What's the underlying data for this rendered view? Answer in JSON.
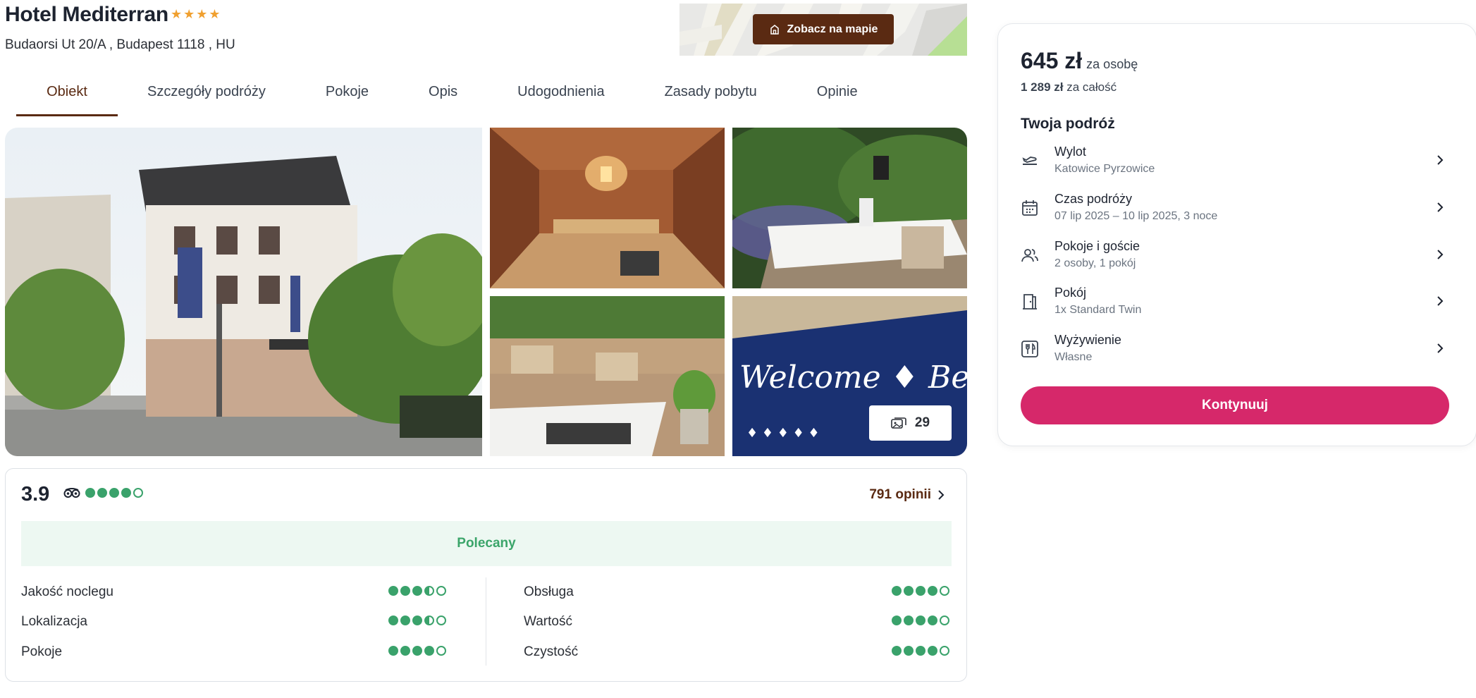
{
  "hotel": {
    "name": "Hotel Mediterran",
    "stars": 4,
    "address": "Budaorsi Ut 20/A , Budapest 1118 , HU"
  },
  "map": {
    "button_label": "Zobacz na mapie",
    "icon": "map-marker-icon"
  },
  "tabs": [
    {
      "label": "Obiekt",
      "active": true
    },
    {
      "label": "Szczegóły podróży",
      "active": false
    },
    {
      "label": "Pokoje",
      "active": false
    },
    {
      "label": "Opis",
      "active": false
    },
    {
      "label": "Udogodnienia",
      "active": false
    },
    {
      "label": "Zasady pobytu",
      "active": false
    },
    {
      "label": "Opinie",
      "active": false
    }
  ],
  "gallery": {
    "photo_count": "29",
    "icon": "gallery-icon"
  },
  "ratings": {
    "score": "3.9",
    "score_dots": 4,
    "reviews_link": "791 opinii",
    "recommendation": "Polecany",
    "categories_left": [
      {
        "label": "Jakość noclegu",
        "value": 3.5
      },
      {
        "label": "Lokalizacja",
        "value": 3.5
      },
      {
        "label": "Pokoje",
        "value": 4
      }
    ],
    "categories_right": [
      {
        "label": "Obsługa",
        "value": 4
      },
      {
        "label": "Wartość",
        "value": 4
      },
      {
        "label": "Czystość",
        "value": 4
      }
    ],
    "colors": {
      "dot": "#3aa26b",
      "recommend_bg": "#edf8f2"
    }
  },
  "sidebar": {
    "price": "645 zł",
    "price_unit": "za osobę",
    "total": "1 289 zł",
    "total_unit": "za całość",
    "trip_title": "Twoja podróż",
    "items": [
      {
        "label": "Wylot",
        "value": "Katowice Pyrzowice",
        "icon": "plane-icon"
      },
      {
        "label": "Czas podróży",
        "value": "07 lip 2025 – 10 lip 2025, 3 noce",
        "icon": "calendar-icon"
      },
      {
        "label": "Pokoje i goście",
        "value": "2 osoby, 1 pokój",
        "icon": "guests-icon"
      },
      {
        "label": "Pokój",
        "value": "1x Standard Twin",
        "icon": "door-icon"
      },
      {
        "label": "Wyżywienie",
        "value": "Własne",
        "icon": "cutlery-icon"
      }
    ],
    "continue_label": "Kontynuuj",
    "colors": {
      "accent": "#d6286a",
      "brand": "#5a2a12"
    }
  }
}
